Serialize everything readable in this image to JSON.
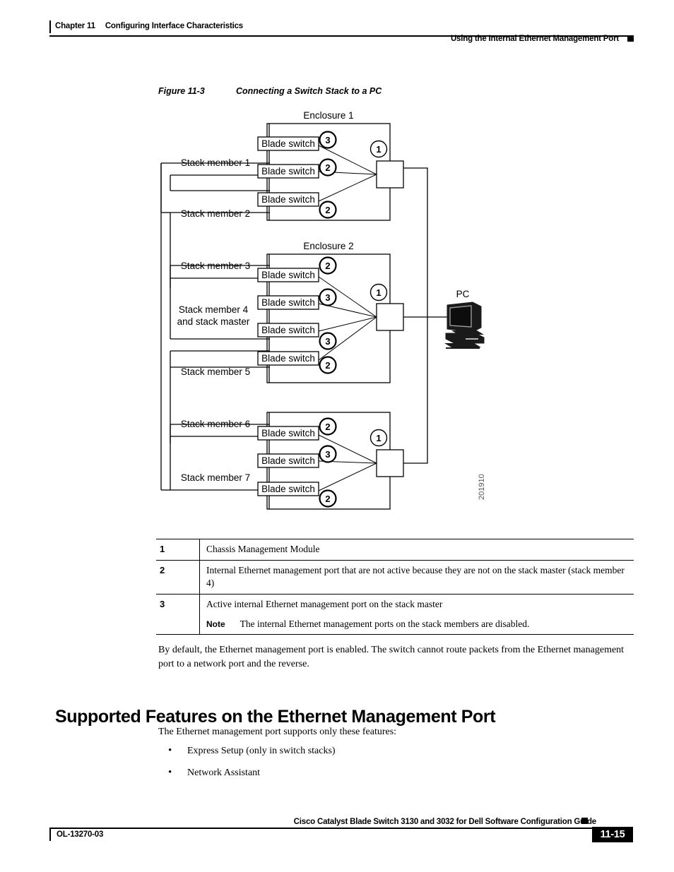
{
  "header": {
    "chapter": "Chapter 11",
    "chapter_title": "Configuring Interface Characteristics",
    "section_title": "Using the Internal Ethernet Management Port"
  },
  "figure": {
    "label": "Figure 11-3",
    "title": "Connecting a Switch Stack to a PC",
    "figure_id": "201910",
    "pc_label": "PC",
    "blade_switch_label": "Blade switch",
    "enclosures": [
      {
        "label": "Enclosure 1"
      },
      {
        "label": "Enclosure 2"
      },
      {
        "label": ""
      }
    ],
    "stack_members": [
      {
        "label": "Stack member 1"
      },
      {
        "label": "Stack member 2"
      },
      {
        "label": "Stack member 3"
      },
      {
        "label": "Stack member 4"
      },
      {
        "label": "and stack master"
      },
      {
        "label": "Stack member 5"
      },
      {
        "label": "Stack member 6"
      },
      {
        "label": "Stack member 7"
      }
    ],
    "callouts": {
      "cmm": "1",
      "inactive_port": "2",
      "active_port": "3"
    },
    "blade_callouts_group1": [
      "3",
      "2",
      "2"
    ],
    "blade_callouts_group2": [
      "2",
      "3",
      "3",
      "2"
    ],
    "blade_callouts_group3": [
      "2",
      "3",
      "2"
    ]
  },
  "legend": {
    "rows": [
      {
        "key": "1",
        "text": "Chassis Management Module"
      },
      {
        "key": "2",
        "text": "Internal Ethernet management port that are not active because they are not on the stack master (stack member 4)"
      },
      {
        "key": "3",
        "text": "Active internal Ethernet management port on the stack master",
        "note_keyword": "Note",
        "note_text": "The internal Ethernet management ports on the stack members are disabled."
      }
    ]
  },
  "body": {
    "default_paragraph": "By default, the Ethernet management port is enabled. The switch cannot route packets from the Ethernet management port to a network port and the reverse.",
    "heading": "Supported Features on the Ethernet Management Port",
    "intro": "The Ethernet management port supports only these features:",
    "bullets": [
      {
        "text": "Express Setup (only in switch stacks)"
      },
      {
        "text": "Network Assistant"
      }
    ],
    "bullet_glyph": "•"
  },
  "footer": {
    "guide_title": "Cisco Catalyst Blade Switch 3130 and 3032 for Dell Software Configuration Guide",
    "doc_number": "OL-13270-03",
    "page_number": "11-15"
  }
}
